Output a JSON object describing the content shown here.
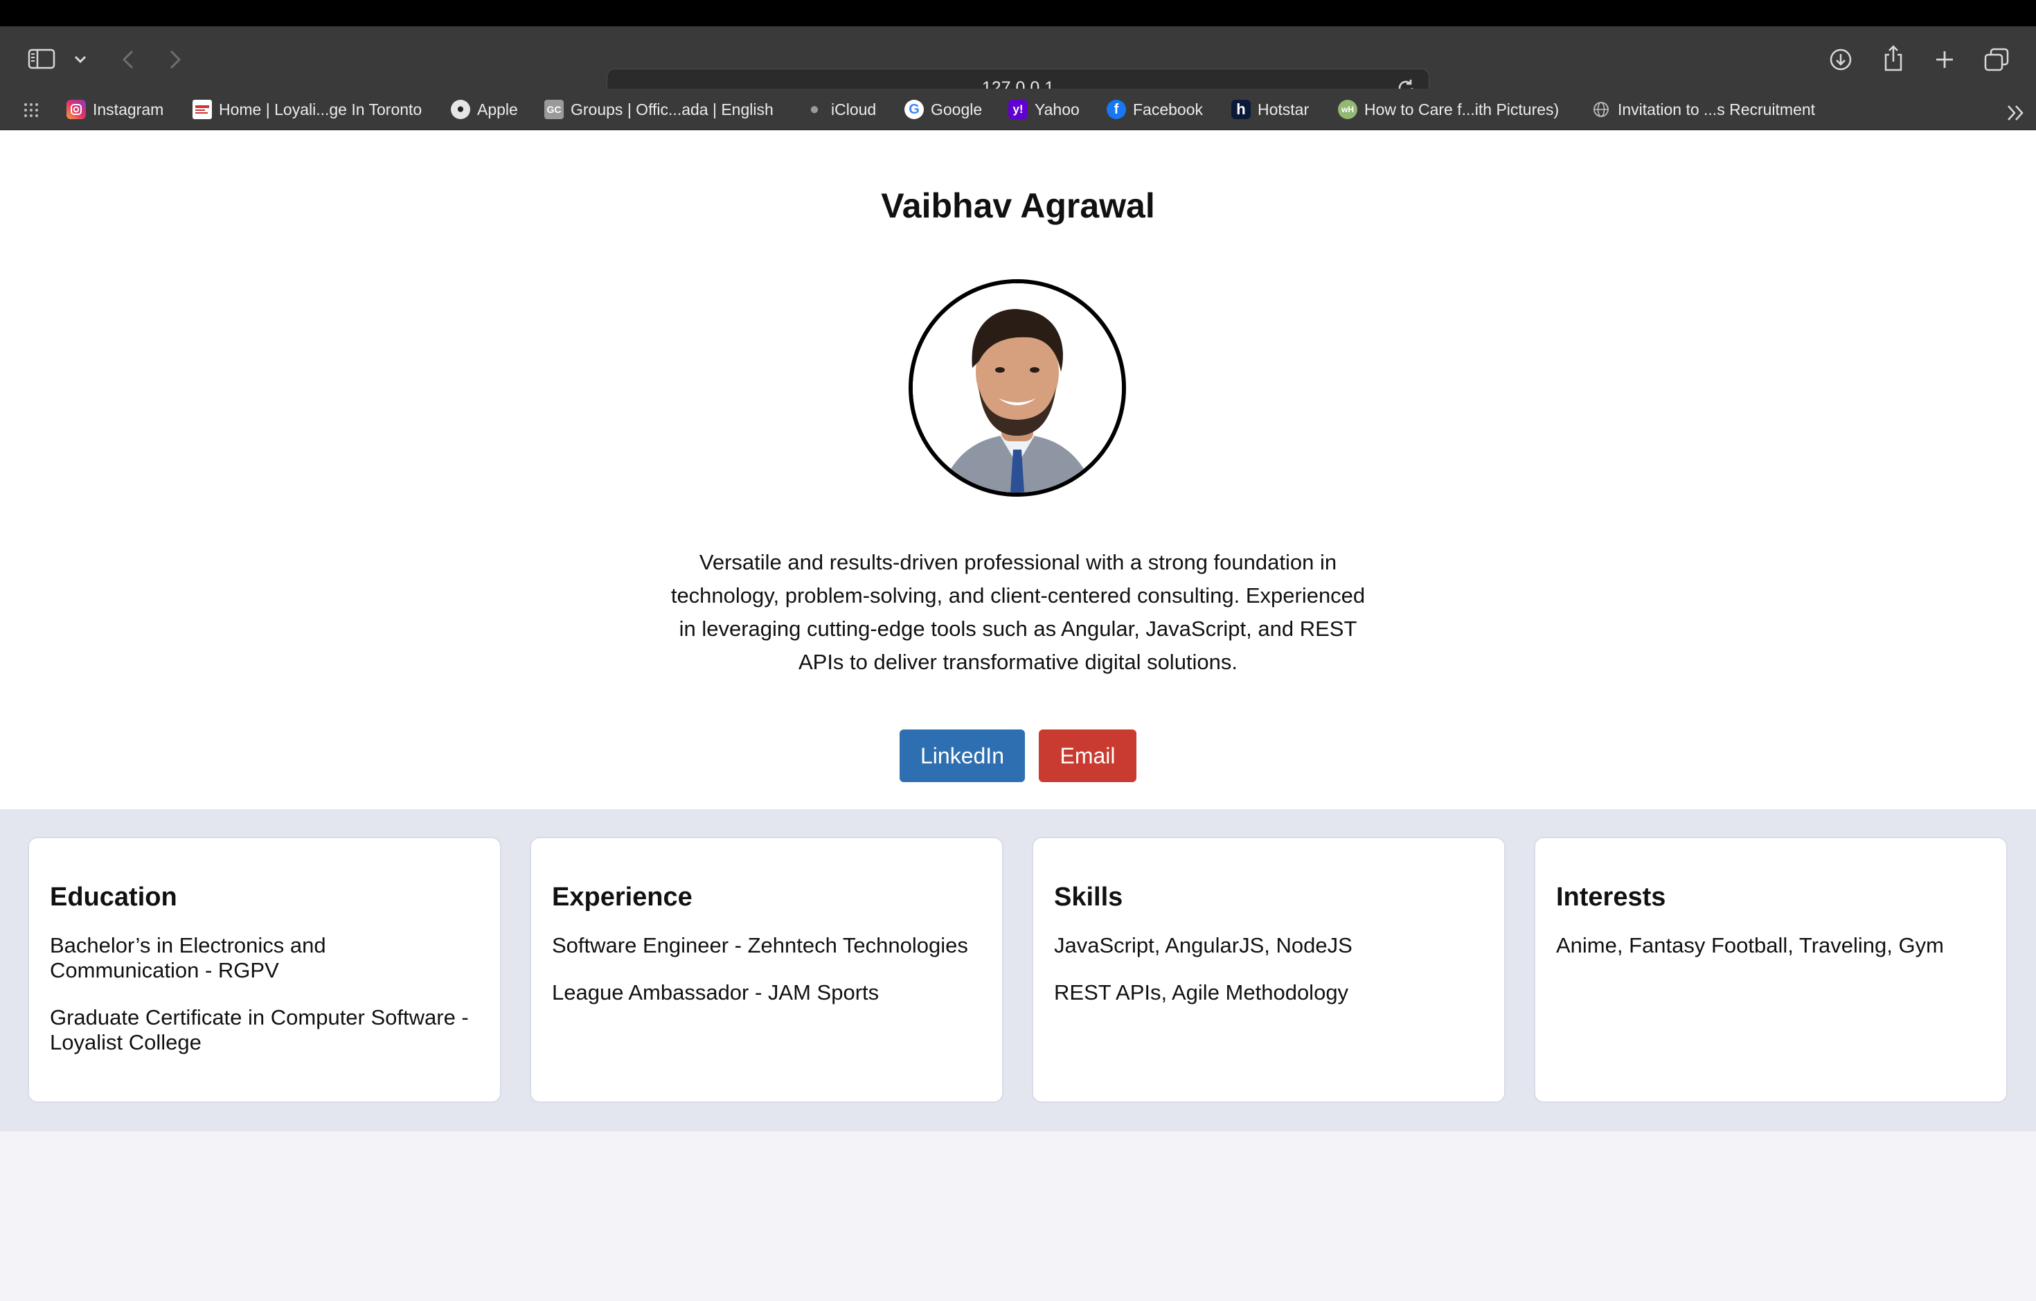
{
  "browser": {
    "url": "127.0.0.1",
    "bookmarks": [
      {
        "label": "Instagram",
        "icon": "instagram-icon"
      },
      {
        "label": "Home | Loyali...ge In Toronto",
        "icon": "loyalist-icon"
      },
      {
        "label": "Apple",
        "icon": "apple-icon"
      },
      {
        "label": "Groups | Offic...ada | English",
        "icon": "groups-icon"
      },
      {
        "label": "iCloud",
        "icon": "icloud-icon"
      },
      {
        "label": "Google",
        "icon": "google-icon"
      },
      {
        "label": "Yahoo",
        "icon": "yahoo-icon"
      },
      {
        "label": "Facebook",
        "icon": "facebook-icon"
      },
      {
        "label": "Hotstar",
        "icon": "hotstar-icon"
      },
      {
        "label": "How to Care f...ith Pictures)",
        "icon": "wikihow-icon"
      },
      {
        "label": "Invitation to ...s Recruitment",
        "icon": "globe-icon"
      }
    ]
  },
  "profile": {
    "name": "Vaibhav Agrawal",
    "bio": "Versatile and results-driven professional with a strong foundation in technology, problem-solving, and client-centered consulting. Experienced in leveraging cutting-edge tools such as Angular, JavaScript, and REST APIs to deliver transformative digital solutions.",
    "linkedin_label": "LinkedIn",
    "email_label": "Email"
  },
  "sections": {
    "education": {
      "title": "Education",
      "items": [
        "Bachelor’s in Electronics and Communication - RGPV",
        "Graduate Certificate in Computer Software - Loyalist College"
      ]
    },
    "experience": {
      "title": "Experience",
      "items": [
        "Software Engineer - Zehntech Technologies",
        "League Ambassador - JAM Sports"
      ]
    },
    "skills": {
      "title": "Skills",
      "items": [
        "JavaScript, AngularJS, NodeJS",
        "REST APIs, Agile Methodology"
      ]
    },
    "interests": {
      "title": "Interests",
      "items": [
        "Anime, Fantasy Football, Traveling, Gym"
      ]
    }
  },
  "colors": {
    "linkedin": "#2e6fb2",
    "email": "#c93b30",
    "cards_band": "#e3e6ef",
    "chrome": "#3a3a3a"
  }
}
